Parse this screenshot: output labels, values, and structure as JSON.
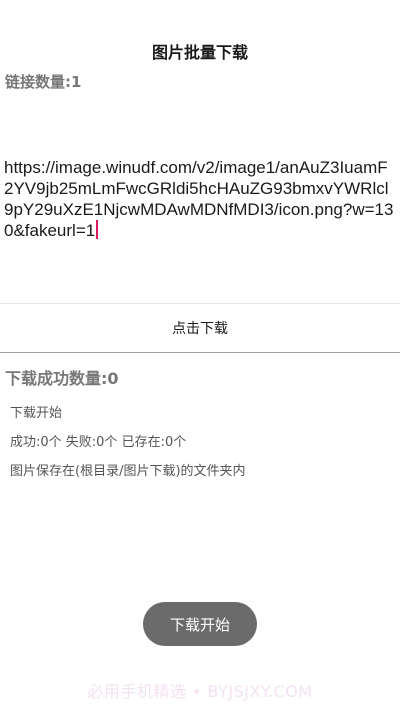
{
  "header": {
    "title": "图片批量下载"
  },
  "input": {
    "link_count": "链接数量:1",
    "url_value": "https://image.winudf.com/v2/image1/anAuZ3IuamF2YV9jb25mLmFwcGRldi5hcHAuZG93bmxvYWRlcl9pY29uXzE1NjcwMDAwMDNfMDI3/icon.png?w=130&fakeurl=1",
    "cursor_color": "#d81b60"
  },
  "actions": {
    "download_label": "点击下载"
  },
  "result": {
    "success_count": "下载成功数量:0",
    "log": [
      "下载开始",
      "成功:0个 失败:0个 已存在:0个",
      "图片保存在(根目录/图片下载)的文件夹内"
    ]
  },
  "toast": {
    "message": "下载开始"
  },
  "watermark": {
    "text": "必用手机精选 • BYJSJXY.COM"
  }
}
